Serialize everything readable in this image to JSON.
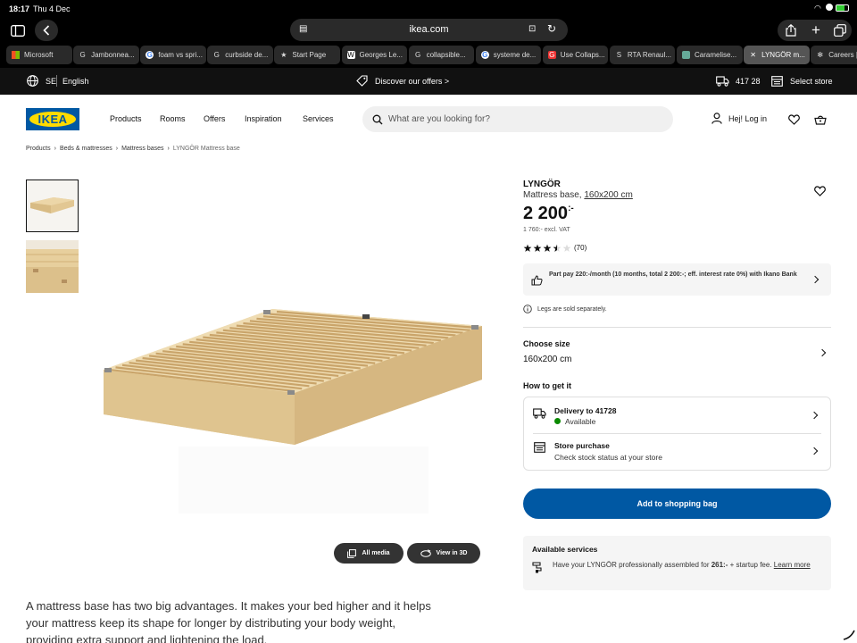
{
  "status": {
    "time": "18:17",
    "date": "Thu 4 Dec"
  },
  "browser": {
    "url": "ikea.com",
    "tabs": [
      {
        "label": "Microsoft",
        "fav": "ms"
      },
      {
        "label": "Jambonnea...",
        "fav": "G"
      },
      {
        "label": "foam vs spri...",
        "fav": "google"
      },
      {
        "label": "curbside de...",
        "fav": "G"
      },
      {
        "label": "Start Page",
        "fav": "star"
      },
      {
        "label": "Georges Le...",
        "fav": "W"
      },
      {
        "label": "collapsible...",
        "fav": "G"
      },
      {
        "label": "systeme de...",
        "fav": "google"
      },
      {
        "label": "Use Collaps...",
        "fav": "G-red"
      },
      {
        "label": "RTA Renaul...",
        "fav": "S"
      },
      {
        "label": "Caramelise...",
        "fav": "img"
      },
      {
        "label": "LYNGÖR m...",
        "fav": "close"
      },
      {
        "label": "Careers | A...",
        "fav": "gear"
      }
    ]
  },
  "topbar": {
    "country": "SE",
    "language": "English",
    "offers": "Discover our offers >",
    "postcode": "417 28",
    "store": "Select store"
  },
  "header": {
    "logo": "IKEA",
    "nav": [
      "Products",
      "Rooms",
      "Offers",
      "Inspiration",
      "Services"
    ],
    "search_placeholder": "What are you looking for?",
    "login": "Hej! Log in"
  },
  "breadcrumb": [
    "Products",
    "Beds & mattresses",
    "Mattress bases",
    "LYNGÖR Mattress base"
  ],
  "media": {
    "all_media": "All media",
    "view_3d": "View in 3D"
  },
  "product": {
    "name": "LYNGÖR",
    "type": "Mattress base,",
    "size_link": "160x200 cm",
    "price": "2 200",
    "price_suffix": ":-",
    "excl_vat": "1 760:- excl. VAT",
    "rating": 3.5,
    "reviews": "(70)",
    "partpay": "Part pay 220:-/month (10 months, total 2 200:-; eff. interest rate 0%) with Ikano Bank",
    "legs_note": "Legs are sold separately.",
    "choose_size_label": "Choose size",
    "choose_size_value": "160x200 cm",
    "how_to_get": "How to get it",
    "delivery_title": "Delivery to 41728",
    "delivery_status": "Available",
    "store_title": "Store purchase",
    "store_sub": "Check stock status at your store",
    "add_to_bag": "Add to shopping bag",
    "services_title": "Available services",
    "services_text_1": "Have your LYNGÖR professionally assembled for ",
    "services_price": "261:-",
    "services_text_2": " + startup fee. ",
    "learn_more": "Learn more"
  },
  "description": "A mattress base has two big advantages. It makes your bed higher and it helps your mattress keep its shape for longer by distributing your body weight, providing extra support and lightening the load.",
  "colors": {
    "ikea_blue": "#0058a3",
    "ikea_yellow": "#ffdb00",
    "available_green": "#0a8a00"
  }
}
